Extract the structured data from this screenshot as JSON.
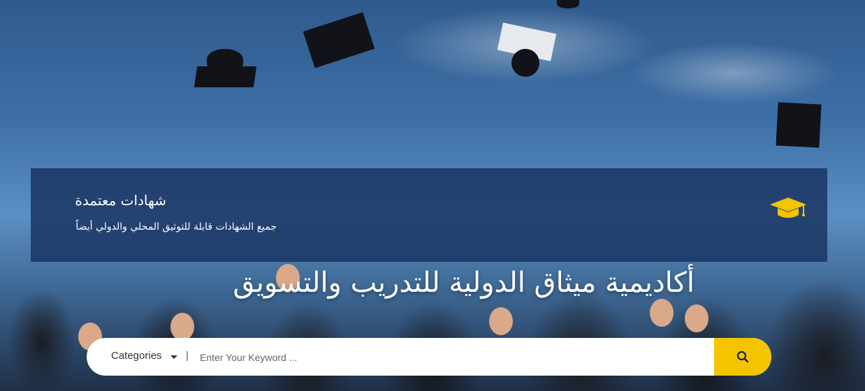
{
  "panel": {
    "title": "شهادات معتمدة",
    "subtitle": "جميع الشهادات قابلة للتوثيق المحلي والدولي أيضاً",
    "icon": "graduation-cap-icon",
    "icon_color": "#f5c400"
  },
  "hero": {
    "title": "أكاديمية ميثاق الدولية للتدريب والتسويق"
  },
  "search": {
    "category_label": "Categories",
    "separator": "|",
    "placeholder": "Enter Your Keyword ...",
    "value": "",
    "button_icon": "search-icon",
    "button_color": "#f5c400"
  }
}
